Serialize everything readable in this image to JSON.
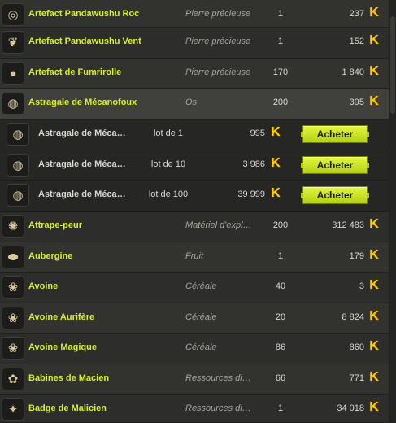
{
  "currency_icon": "kama-icon",
  "accent_color": "#d7f028",
  "rows": [
    {
      "kind": "item",
      "name": "Artefact Pandawushu Roc",
      "category": "Pierre précieuse",
      "qty": "1",
      "price": "237",
      "icon": "eye-amulet-icon",
      "glyph": "◎"
    },
    {
      "kind": "item",
      "name": "Artefact Pandawushu Vent",
      "category": "Pierre précieuse",
      "qty": "1",
      "price": "152",
      "icon": "wind-amulet-icon",
      "glyph": "❦"
    },
    {
      "kind": "item",
      "name": "Artefact de Fumrirolle",
      "category": "Pierre précieuse",
      "qty": "170",
      "price": "1 840",
      "icon": "bomb-icon",
      "glyph": "●"
    },
    {
      "kind": "item",
      "name": "Astragale de Mécanofoux",
      "category": "Os",
      "qty": "200",
      "price": "395",
      "icon": "astragal-icon",
      "glyph": "◍",
      "selected": true
    },
    {
      "kind": "lot",
      "name": "Astragale de Mécanofoux",
      "lot": "lot de 1",
      "price": "995",
      "icon": "astragal-icon",
      "glyph": "◍",
      "button": "Acheter"
    },
    {
      "kind": "lot",
      "name": "Astragale de Mécanofoux",
      "lot": "lot de 10",
      "price": "3 986",
      "icon": "astragal-icon",
      "glyph": "◍",
      "button": "Acheter"
    },
    {
      "kind": "lot",
      "name": "Astragale de Mécanofoux",
      "lot": "lot de 100",
      "price": "39 999",
      "icon": "astragal-icon",
      "glyph": "◍",
      "button": "Acheter"
    },
    {
      "kind": "item",
      "name": "Attrape-peur",
      "category": "Matériel d'exploration",
      "qty": "200",
      "price": "312 483",
      "icon": "dreamcatcher-icon",
      "glyph": "✺"
    },
    {
      "kind": "item",
      "name": "Aubergine",
      "category": "Fruit",
      "qty": "1",
      "price": "179",
      "icon": "eggplant-icon",
      "glyph": "⬬"
    },
    {
      "kind": "item",
      "name": "Avoine",
      "category": "Céréale",
      "qty": "40",
      "price": "3",
      "icon": "oat-icon",
      "glyph": "❀"
    },
    {
      "kind": "item",
      "name": "Avoine Aurifère",
      "category": "Céréale",
      "qty": "20",
      "price": "8 824",
      "icon": "golden-oat-icon",
      "glyph": "❀"
    },
    {
      "kind": "item",
      "name": "Avoine Magique",
      "category": "Céréale",
      "qty": "86",
      "price": "860",
      "icon": "magic-oat-icon",
      "glyph": "❀"
    },
    {
      "kind": "item",
      "name": "Babines de Macien",
      "category": "Ressources diverses",
      "qty": "66",
      "price": "771",
      "icon": "lips-icon",
      "glyph": "✿"
    },
    {
      "kind": "item",
      "name": "Badge de Malicien",
      "category": "Ressources diverses",
      "qty": "1",
      "price": "34 018",
      "icon": "badge-icon",
      "glyph": "✦"
    }
  ]
}
